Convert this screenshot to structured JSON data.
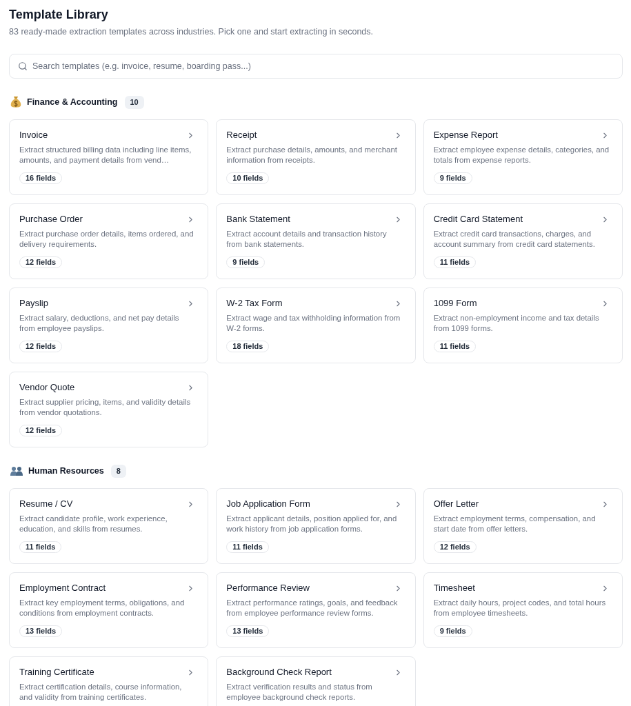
{
  "header": {
    "title": "Template Library",
    "subtitle": "83 ready-made extraction templates across industries. Pick one and start extracting in seconds."
  },
  "search": {
    "placeholder": "Search templates (e.g. invoice, resume, boarding pass...)"
  },
  "sections": [
    {
      "kind": "money",
      "name": "Finance & Accounting",
      "count": "10",
      "templates": [
        {
          "title": "Invoice",
          "description": "Extract structured billing data including line items, amounts, and payment details from vend…",
          "fields": "16 fields"
        },
        {
          "title": "Receipt",
          "description": "Extract purchase details, amounts, and merchant information from receipts.",
          "fields": "10 fields"
        },
        {
          "title": "Expense Report",
          "description": "Extract employee expense details, categories, and totals from expense reports.",
          "fields": "9 fields"
        },
        {
          "title": "Purchase Order",
          "description": "Extract purchase order details, items ordered, and delivery requirements.",
          "fields": "12 fields"
        },
        {
          "title": "Bank Statement",
          "description": "Extract account details and transaction history from bank statements.",
          "fields": "9 fields"
        },
        {
          "title": "Credit Card Statement",
          "description": "Extract credit card transactions, charges, and account summary from credit card statements.",
          "fields": "11 fields"
        },
        {
          "title": "Payslip",
          "description": "Extract salary, deductions, and net pay details from employee payslips.",
          "fields": "12 fields"
        },
        {
          "title": "W-2 Tax Form",
          "description": "Extract wage and tax withholding information from W-2 forms.",
          "fields": "18 fields"
        },
        {
          "title": "1099 Form",
          "description": "Extract non-employment income and tax details from 1099 forms.",
          "fields": "11 fields"
        },
        {
          "title": "Vendor Quote",
          "description": "Extract supplier pricing, items, and validity details from vendor quotations.",
          "fields": "12 fields"
        }
      ]
    },
    {
      "kind": "people",
      "name": "Human Resources",
      "count": "8",
      "templates": [
        {
          "title": "Resume / CV",
          "description": "Extract candidate profile, work experience, education, and skills from resumes.",
          "fields": "11 fields"
        },
        {
          "title": "Job Application Form",
          "description": "Extract applicant details, position applied for, and work history from job application forms.",
          "fields": "11 fields"
        },
        {
          "title": "Offer Letter",
          "description": "Extract employment terms, compensation, and start date from offer letters.",
          "fields": "12 fields"
        },
        {
          "title": "Employment Contract",
          "description": "Extract key employment terms, obligations, and conditions from employment contracts.",
          "fields": "13 fields"
        },
        {
          "title": "Performance Review",
          "description": "Extract performance ratings, goals, and feedback from employee performance review forms.",
          "fields": "13 fields"
        },
        {
          "title": "Timesheet",
          "description": "Extract daily hours, project codes, and total hours from employee timesheets.",
          "fields": "9 fields"
        },
        {
          "title": "Training Certificate",
          "description": "Extract certification details, course information, and validity from training certificates."
        },
        {
          "title": "Background Check Report",
          "description": "Extract verification results and status from employee background check reports."
        }
      ]
    }
  ]
}
